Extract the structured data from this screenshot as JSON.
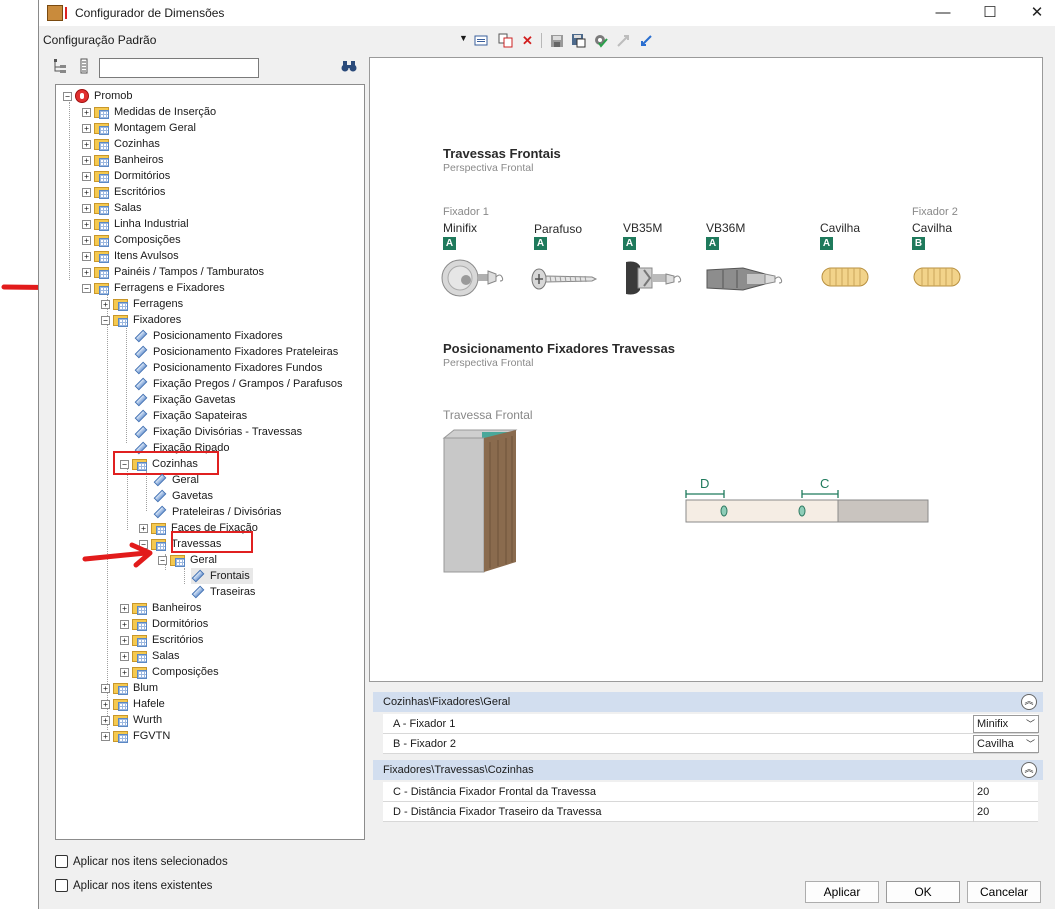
{
  "window": {
    "title": "Configurador de Dimensões",
    "minimize": "—",
    "maximize": "☐",
    "close": "✕"
  },
  "toolbar": {
    "config_name": "Configuração Padrão",
    "dropdown_arrow": "▼"
  },
  "search": {
    "value": "",
    "placeholder": ""
  },
  "tree": {
    "root": "Promob",
    "items": [
      "Medidas de Inserção",
      "Montagem Geral",
      "Cozinhas",
      "Banheiros",
      "Dormitórios",
      "Escritórios",
      "Salas",
      "Linha Industrial",
      "Composições",
      "Itens Avulsos",
      "Painéis / Tampos / Tamburatos",
      "Ferragens e Fixadores",
      "Ferragens",
      "Fixadores",
      "Posicionamento Fixadores",
      "Posicionamento Fixadores Prateleiras",
      "Posicionamento Fixadores Fundos",
      "Fixação Pregos / Grampos / Parafusos",
      "Fixação Gavetas",
      "Fixação Sapateiras",
      "Fixação Divisórias - Travessas",
      "Fixação Ripado",
      "Cozinhas",
      "Geral",
      "Gavetas",
      "Prateleiras / Divisórias",
      "Faces de Fixação",
      "Travessas",
      "Geral",
      "Frontais",
      "Traseiras",
      "Banheiros",
      "Dormitórios",
      "Escritórios",
      "Salas",
      "Composições",
      "Blum",
      "Hafele",
      "Wurth",
      "FGVTN"
    ]
  },
  "preview": {
    "section1_title": "Travessas Frontais",
    "section1_sub": "Perspectiva Frontal",
    "fixador1_label": "Fixador 1",
    "fixador2_label": "Fixador 2",
    "fixadores": [
      {
        "name": "Minifix",
        "badge": "A"
      },
      {
        "name": "Parafuso",
        "badge": "A"
      },
      {
        "name": "VB35M",
        "badge": "A"
      },
      {
        "name": "VB36M",
        "badge": "A"
      },
      {
        "name": "Cavilha",
        "badge": "A"
      },
      {
        "name": "Cavilha",
        "badge": "B"
      }
    ],
    "section2_title": "Posicionamento Fixadores Travessas",
    "section2_sub": "Perspectiva Frontal",
    "travessa_label": "Travessa Frontal",
    "dim_d": "D",
    "dim_c": "C"
  },
  "props": {
    "group1": {
      "title": "Cozinhas\\Fixadores\\Geral",
      "rows": [
        {
          "name": "A - Fixador 1",
          "value": "Minifix"
        },
        {
          "name": "B - Fixador 2",
          "value": "Cavilha"
        }
      ]
    },
    "group2": {
      "title": "Fixadores\\Travessas\\Cozinhas",
      "rows": [
        {
          "name": "C - Distância Fixador Frontal da Travessa",
          "value": "20"
        },
        {
          "name": "D - Distância Fixador Traseiro da Travessa",
          "value": "20"
        }
      ]
    },
    "collapse_icon": "︽"
  },
  "options": {
    "apply_selected": "Aplicar nos itens selecionados",
    "apply_existing": "Aplicar nos itens existentes"
  },
  "buttons": {
    "apply": "Aplicar",
    "ok": "OK",
    "cancel": "Cancelar"
  },
  "colors": {
    "accent_green": "#1f7a5c",
    "highlight_red": "#e02020",
    "group_header": "#d2deef"
  }
}
